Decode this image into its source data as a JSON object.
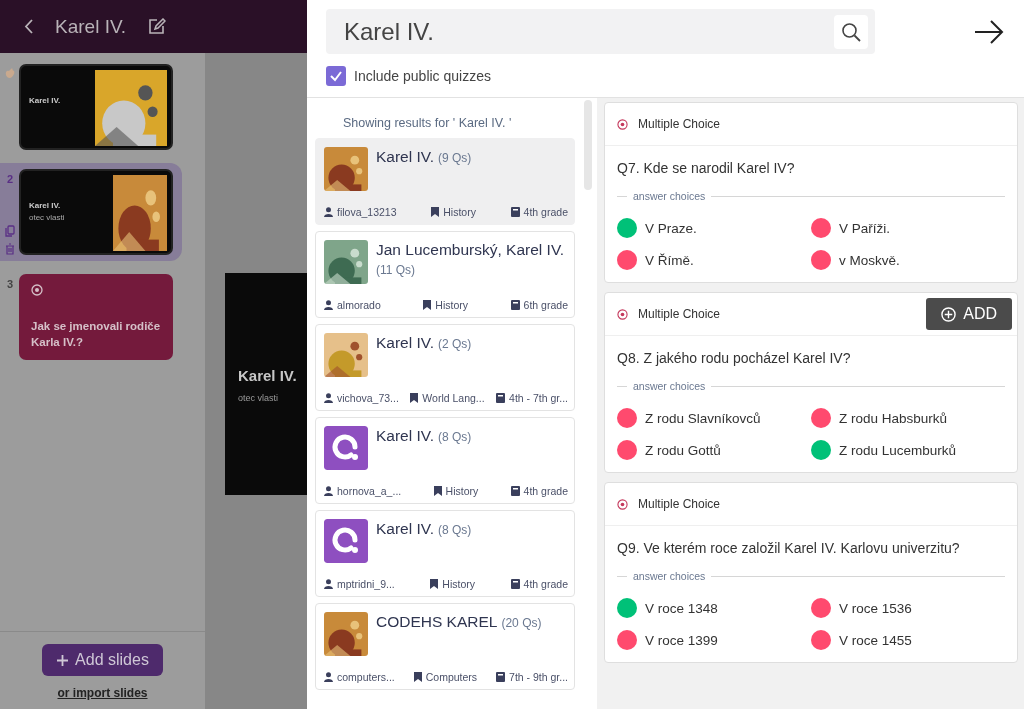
{
  "app": {
    "title": "Karel IV.",
    "slides": [
      {
        "kind": "title",
        "selected": false,
        "title": "Karel IV."
      },
      {
        "kind": "title",
        "number": "2",
        "selected": true,
        "title": "Karel IV.",
        "subtitle": "otec vlasti"
      },
      {
        "kind": "question",
        "number": "3",
        "selected": false,
        "text": "Jak se jmenovali rodiče Karla IV.?"
      }
    ],
    "preview": {
      "title": "Karel IV.",
      "subtitle": "otec vlasti"
    },
    "add_button": "Add slides",
    "import_link": "or import slides"
  },
  "search": {
    "value": "Karel IV."
  },
  "include_public": {
    "label": "Include public quizzes",
    "checked": true
  },
  "results_caption": "Showing results for ' Karel IV. '",
  "results": [
    {
      "title": "Karel IV.",
      "count": "(9 Qs)",
      "author": "filova_13213",
      "subject": "History",
      "grade": "4th grade",
      "selected": true
    },
    {
      "title": "Jan Lucemburský, Karel IV.",
      "count": "(11 Qs)",
      "author": "almorado",
      "subject": "History",
      "grade": "6th grade",
      "selected": false
    },
    {
      "title": "Karel IV.",
      "count": "(2 Qs)",
      "author": "vichova_73...",
      "subject": "World Lang...",
      "grade": "4th - 7th gr...",
      "selected": false
    },
    {
      "title": "Karel IV.",
      "count": "(8 Qs)",
      "thumbnail": {
        "kind": "logo"
      },
      "author": "hornova_a_...",
      "subject": "History",
      "grade": "4th grade",
      "selected": false
    },
    {
      "title": "Karel IV.",
      "count": "(8 Qs)",
      "thumbnail": {
        "kind": "logo"
      },
      "author": "mptridni_9...",
      "subject": "History",
      "grade": "4th grade",
      "selected": false
    },
    {
      "title": "CODEHS KAREL",
      "count": "(20 Qs)",
      "author": "computers...",
      "subject": "Computers",
      "grade": "7th - 9th gr...",
      "selected": false
    }
  ],
  "questions": [
    {
      "type": "Multiple Choice",
      "text": "Q7. Kde se narodil Karel IV?",
      "divider": "answer choices",
      "choices": [
        {
          "text": "V Praze.",
          "correct": true
        },
        {
          "text": "V Paříži.",
          "correct": false
        },
        {
          "text": "V Římě.",
          "correct": false
        },
        {
          "text": "v Moskvě.",
          "correct": false
        }
      ]
    },
    {
      "type": "Multiple Choice",
      "add_button": "ADD",
      "text": "Q8. Z jakého rodu pocházel Karel IV?",
      "divider": "answer choices",
      "choices": [
        {
          "text": "Z rodu Slavníkovců",
          "correct": false
        },
        {
          "text": "Z rodu Habsburků",
          "correct": false
        },
        {
          "text": "Z rodu Gottů",
          "correct": false
        },
        {
          "text": "Z rodu Lucemburků",
          "correct": true
        }
      ]
    },
    {
      "type": "Multiple Choice",
      "text": "Q9. Ve kterém roce založil Karel IV. Karlovu univerzitu?",
      "divider": "answer choices",
      "choices": [
        {
          "text": "V roce 1348",
          "correct": true
        },
        {
          "text": "V roce 1536",
          "correct": false
        },
        {
          "text": "V roce 1399",
          "correct": false
        },
        {
          "text": "V roce 1455",
          "correct": false
        }
      ]
    }
  ]
}
